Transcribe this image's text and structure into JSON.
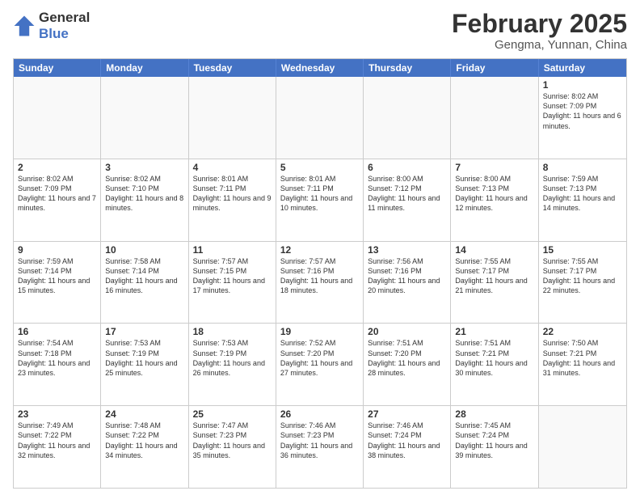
{
  "logo": {
    "general": "General",
    "blue": "Blue"
  },
  "title": "February 2025",
  "location": "Gengma, Yunnan, China",
  "header_days": [
    "Sunday",
    "Monday",
    "Tuesday",
    "Wednesday",
    "Thursday",
    "Friday",
    "Saturday"
  ],
  "rows": [
    [
      {
        "day": "",
        "info": ""
      },
      {
        "day": "",
        "info": ""
      },
      {
        "day": "",
        "info": ""
      },
      {
        "day": "",
        "info": ""
      },
      {
        "day": "",
        "info": ""
      },
      {
        "day": "",
        "info": ""
      },
      {
        "day": "1",
        "info": "Sunrise: 8:02 AM\nSunset: 7:09 PM\nDaylight: 11 hours and 6 minutes."
      }
    ],
    [
      {
        "day": "2",
        "info": "Sunrise: 8:02 AM\nSunset: 7:09 PM\nDaylight: 11 hours and 7 minutes."
      },
      {
        "day": "3",
        "info": "Sunrise: 8:02 AM\nSunset: 7:10 PM\nDaylight: 11 hours and 8 minutes."
      },
      {
        "day": "4",
        "info": "Sunrise: 8:01 AM\nSunset: 7:11 PM\nDaylight: 11 hours and 9 minutes."
      },
      {
        "day": "5",
        "info": "Sunrise: 8:01 AM\nSunset: 7:11 PM\nDaylight: 11 hours and 10 minutes."
      },
      {
        "day": "6",
        "info": "Sunrise: 8:00 AM\nSunset: 7:12 PM\nDaylight: 11 hours and 11 minutes."
      },
      {
        "day": "7",
        "info": "Sunrise: 8:00 AM\nSunset: 7:13 PM\nDaylight: 11 hours and 12 minutes."
      },
      {
        "day": "8",
        "info": "Sunrise: 7:59 AM\nSunset: 7:13 PM\nDaylight: 11 hours and 14 minutes."
      }
    ],
    [
      {
        "day": "9",
        "info": "Sunrise: 7:59 AM\nSunset: 7:14 PM\nDaylight: 11 hours and 15 minutes."
      },
      {
        "day": "10",
        "info": "Sunrise: 7:58 AM\nSunset: 7:14 PM\nDaylight: 11 hours and 16 minutes."
      },
      {
        "day": "11",
        "info": "Sunrise: 7:57 AM\nSunset: 7:15 PM\nDaylight: 11 hours and 17 minutes."
      },
      {
        "day": "12",
        "info": "Sunrise: 7:57 AM\nSunset: 7:16 PM\nDaylight: 11 hours and 18 minutes."
      },
      {
        "day": "13",
        "info": "Sunrise: 7:56 AM\nSunset: 7:16 PM\nDaylight: 11 hours and 20 minutes."
      },
      {
        "day": "14",
        "info": "Sunrise: 7:55 AM\nSunset: 7:17 PM\nDaylight: 11 hours and 21 minutes."
      },
      {
        "day": "15",
        "info": "Sunrise: 7:55 AM\nSunset: 7:17 PM\nDaylight: 11 hours and 22 minutes."
      }
    ],
    [
      {
        "day": "16",
        "info": "Sunrise: 7:54 AM\nSunset: 7:18 PM\nDaylight: 11 hours and 23 minutes."
      },
      {
        "day": "17",
        "info": "Sunrise: 7:53 AM\nSunset: 7:19 PM\nDaylight: 11 hours and 25 minutes."
      },
      {
        "day": "18",
        "info": "Sunrise: 7:53 AM\nSunset: 7:19 PM\nDaylight: 11 hours and 26 minutes."
      },
      {
        "day": "19",
        "info": "Sunrise: 7:52 AM\nSunset: 7:20 PM\nDaylight: 11 hours and 27 minutes."
      },
      {
        "day": "20",
        "info": "Sunrise: 7:51 AM\nSunset: 7:20 PM\nDaylight: 11 hours and 28 minutes."
      },
      {
        "day": "21",
        "info": "Sunrise: 7:51 AM\nSunset: 7:21 PM\nDaylight: 11 hours and 30 minutes."
      },
      {
        "day": "22",
        "info": "Sunrise: 7:50 AM\nSunset: 7:21 PM\nDaylight: 11 hours and 31 minutes."
      }
    ],
    [
      {
        "day": "23",
        "info": "Sunrise: 7:49 AM\nSunset: 7:22 PM\nDaylight: 11 hours and 32 minutes."
      },
      {
        "day": "24",
        "info": "Sunrise: 7:48 AM\nSunset: 7:22 PM\nDaylight: 11 hours and 34 minutes."
      },
      {
        "day": "25",
        "info": "Sunrise: 7:47 AM\nSunset: 7:23 PM\nDaylight: 11 hours and 35 minutes."
      },
      {
        "day": "26",
        "info": "Sunrise: 7:46 AM\nSunset: 7:23 PM\nDaylight: 11 hours and 36 minutes."
      },
      {
        "day": "27",
        "info": "Sunrise: 7:46 AM\nSunset: 7:24 PM\nDaylight: 11 hours and 38 minutes."
      },
      {
        "day": "28",
        "info": "Sunrise: 7:45 AM\nSunset: 7:24 PM\nDaylight: 11 hours and 39 minutes."
      },
      {
        "day": "",
        "info": ""
      }
    ]
  ]
}
